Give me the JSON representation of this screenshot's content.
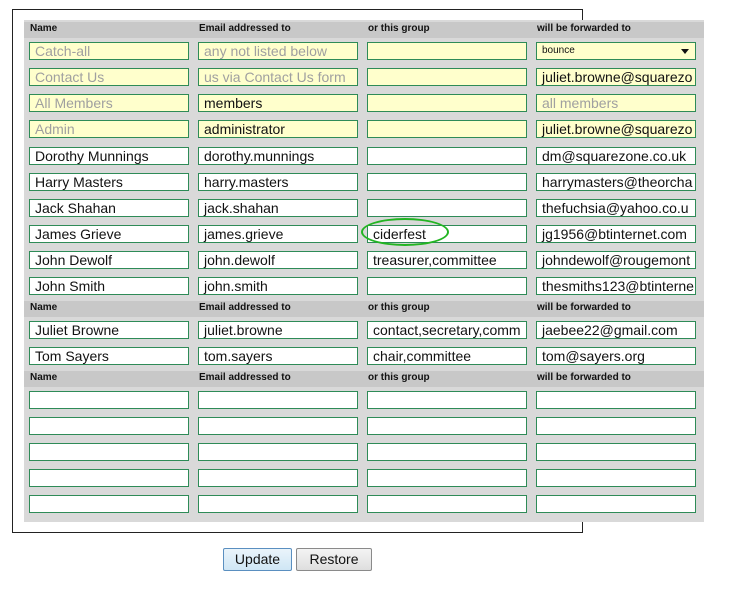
{
  "headers": {
    "name": "Name",
    "email": "Email addressed to",
    "group": "or this group",
    "forward": "will be forwarded to"
  },
  "system_rows": [
    {
      "name": "Catch-all",
      "email": "any not listed below",
      "group": "",
      "forward_select": "bounce"
    },
    {
      "name": "Contact Us",
      "email": "us via Contact Us form",
      "group": "",
      "forward": "juliet.browne@squarezo"
    },
    {
      "name": "All Members",
      "email": "members",
      "group": "",
      "forward": "all members"
    },
    {
      "name": "Admin",
      "email": "administrator",
      "group": "",
      "forward": "juliet.browne@squarezo"
    }
  ],
  "member_rows": [
    {
      "name": "Dorothy Munnings",
      "email": "dorothy.munnings",
      "group": "",
      "forward": "dm@squarezone.co.uk"
    },
    {
      "name": "Harry Masters",
      "email": "harry.masters",
      "group": "",
      "forward": "harrymasters@theorcha"
    },
    {
      "name": "Jack Shahan",
      "email": "jack.shahan",
      "group": "",
      "forward": "thefuchsia@yahoo.co.u"
    },
    {
      "name": "James Grieve",
      "email": "james.grieve",
      "group": "ciderfest",
      "forward": "jg1956@btinternet.com"
    },
    {
      "name": "John Dewolf",
      "email": "john.dewolf",
      "group": "treasurer,committee",
      "forward": "johndewolf@rougemont"
    },
    {
      "name": "John Smith",
      "email": "john.smith",
      "group": "",
      "forward": "thesmiths123@btinterne"
    }
  ],
  "officer_rows": [
    {
      "name": "Juliet Browne",
      "email": "juliet.browne",
      "group": "contact,secretary,comm",
      "forward": "jaebee22@gmail.com"
    },
    {
      "name": "Tom Sayers",
      "email": "tom.sayers",
      "group": "chair,committee",
      "forward": "tom@sayers.org"
    }
  ],
  "buttons": {
    "update": "Update",
    "restore": "Restore"
  }
}
